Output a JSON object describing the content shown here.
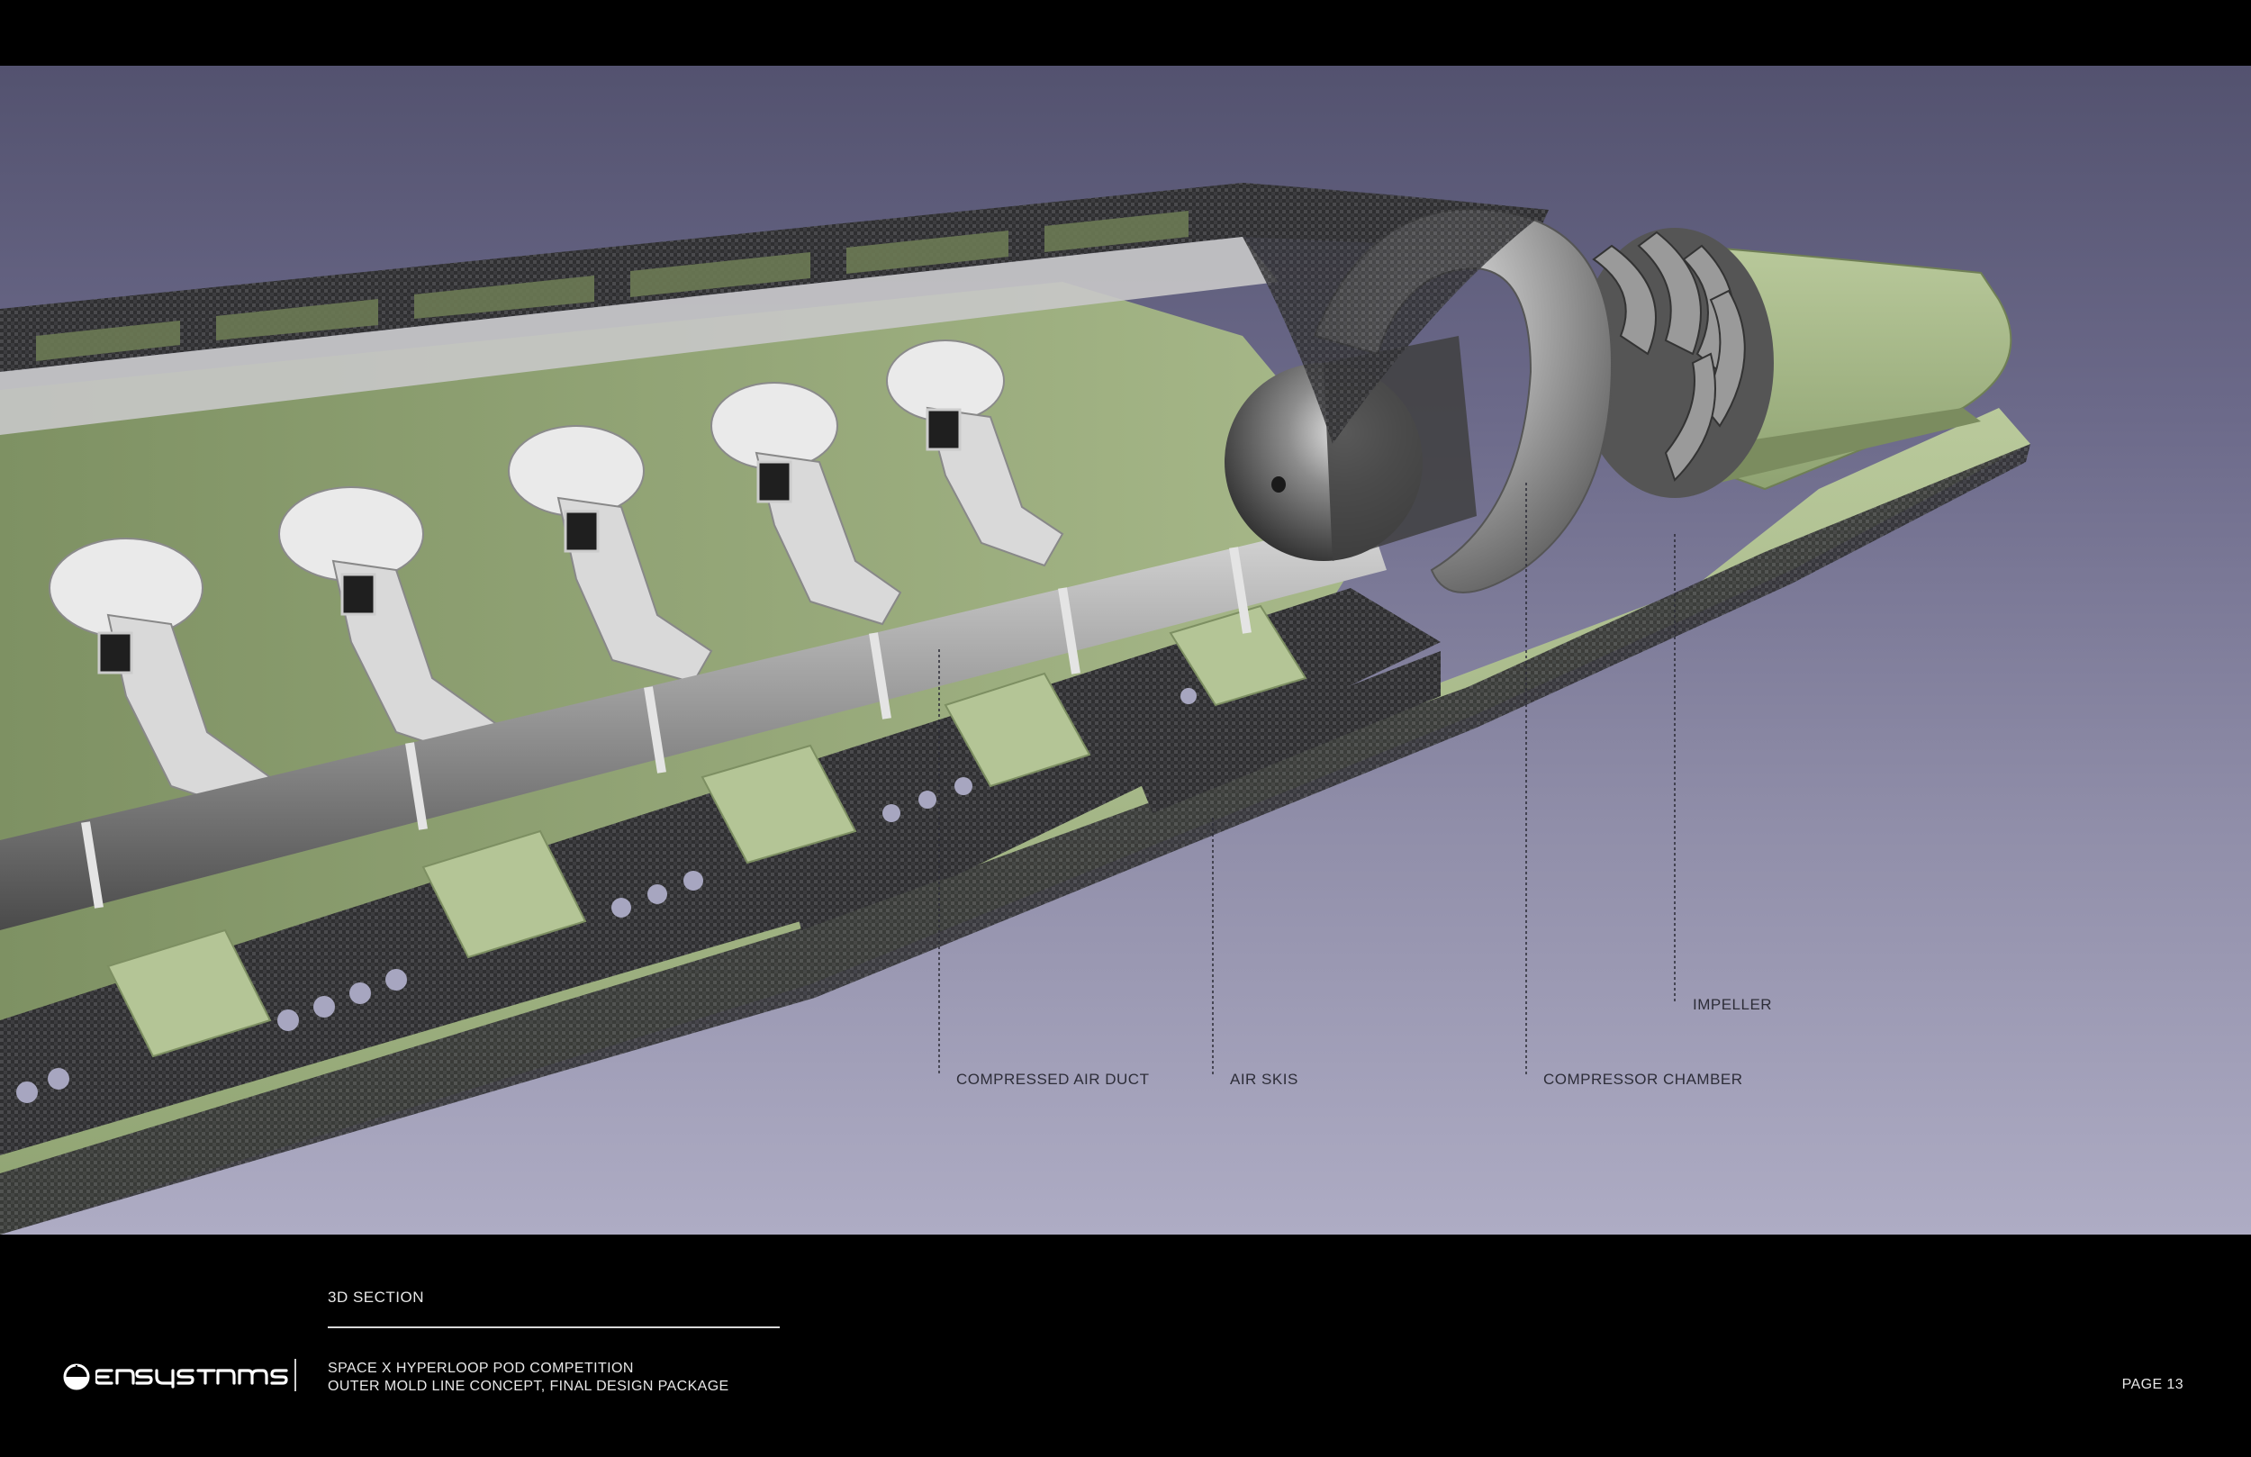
{
  "callouts": [
    {
      "id": "compressed-air-duct",
      "label": "COMPRESSED AIR DUCT"
    },
    {
      "id": "air-skis",
      "label": "AIR SKIS"
    },
    {
      "id": "compressor-chamber",
      "label": "COMPRESSOR CHAMBER"
    },
    {
      "id": "impeller",
      "label": "IMPELLER"
    }
  ],
  "footer": {
    "section_title": "3D SECTION",
    "logo_text": "ensysrems",
    "project_line_1": "SPACE X HYPERLOOP POD COMPETITION",
    "project_line_2": "OUTER MOLD LINE CONCEPT, FINAL DESIGN PACKAGE",
    "page_label": "PAGE 13"
  },
  "colors": {
    "shell_green": "#a6b88a",
    "carbon": "#3a3a3a",
    "background_top": "#53526f",
    "background_bottom": "#aeacc4"
  }
}
